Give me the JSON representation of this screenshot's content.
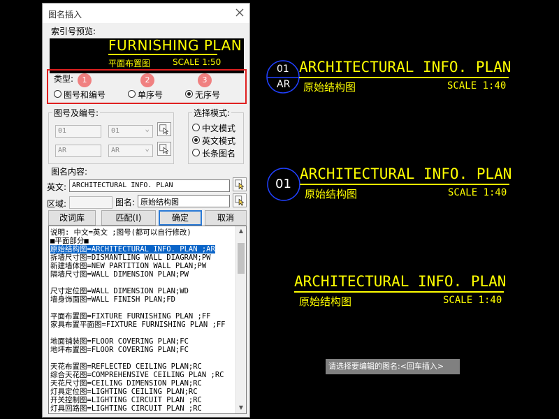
{
  "dialog": {
    "title": "图名插入",
    "preview_label": "索引号预览:",
    "preview": {
      "title": "FURNISHING PLAN",
      "subtitle": "平面布置图",
      "scale": "SCALE 1:50"
    },
    "type_label": "类型:",
    "badges": [
      "1",
      "2",
      "3"
    ],
    "type_options": [
      {
        "label": "图号和编号",
        "selected": false
      },
      {
        "label": "单序号",
        "selected": false
      },
      {
        "label": "无序号",
        "selected": true
      }
    ],
    "number_group_label": "图号及编号:",
    "number_field_1": "01",
    "number_combo_1": "01",
    "number_field_2": "AR",
    "number_combo_2": "AR",
    "mode_group_label": "选择模式:",
    "mode_options": [
      {
        "label": "中文模式",
        "selected": false
      },
      {
        "label": "英文模式",
        "selected": true
      },
      {
        "label": "长条图名",
        "selected": false
      }
    ],
    "content_label": "图名内容:",
    "english_label": "英文:",
    "english_value": "ARCHITECTURAL INFO. PLAN",
    "area_label": "区域:",
    "area_value": "",
    "name_label": "图名:",
    "name_value": "原始结构图",
    "buttons": {
      "edit_lib": "改词库",
      "match": "匹配(I)",
      "ok": "确定",
      "cancel": "取消"
    },
    "list_items": [
      "说明: 中文=英文 ;图号(都可以自行修改)",
      "■平面部分■",
      "原始结构图=ARCHITECTURAL INFO. PLAN ;AR",
      "拆墙尺寸图=DISMANTLING WALL DIAGRAM;PW",
      "新建墙体图=NEW PARTITION WALL PLAN;PW",
      "隔墙尺寸图=WALL DIMENSION PLAN;PW",
      "",
      "尺寸定位图=WALL DIMENSION PLAN;WD",
      "墙身饰面图=WALL FINISH PLAN;FD",
      "",
      "平面布置图=FIXTURE FURNISHING PLAN  ;FF",
      "家具布置平面图=FIXTURE FURNISHING PLAN  ;FF",
      "",
      "地面铺装图=FLOOR COVERING PLAN;FC",
      "地坪布置图=FLOOR COVERING PLAN;FC",
      "",
      "天花布置图=REFLECTED CEILING PLAN;RC",
      "综合天花图=COMPREHENSIVE CEILING PLAN  ;RC",
      "天花尺寸图=CEILING DIMENSION PLAN;RC",
      "灯具定位图=LIGHTING CEILING PLAN;RC",
      "开关控制图=LIGHTING CIRCUIT PLAN  ;RC",
      "灯具回路图=LIGHTING CIRCUIT PLAN  ;RC"
    ],
    "selected_index": 2
  },
  "cad": {
    "block1": {
      "top_num": "01",
      "bottom_num": "AR",
      "title": "ARCHITECTURAL INFO. PLAN",
      "subtitle": "原始结构图",
      "scale": "SCALE 1:40"
    },
    "block2": {
      "num": "01",
      "title": "ARCHITECTURAL INFO. PLAN",
      "subtitle": "原始结构图",
      "scale": "SCALE 1:40"
    },
    "block3": {
      "title": "ARCHITECTURAL INFO. PLAN",
      "subtitle": "原始结构图",
      "scale": "SCALE 1:40"
    },
    "status_prompt": "请选择要编辑的图名:<回车插入>"
  },
  "colors": {
    "cad_yellow": "#ffff00",
    "circle_blue": "#2040ff",
    "highlight_red": "#e02020",
    "selection_blue": "#0a64c8"
  }
}
